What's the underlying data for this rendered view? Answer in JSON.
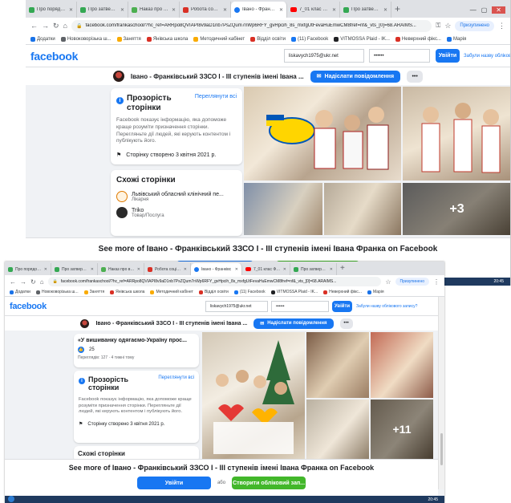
{
  "browser": {
    "tabs": [
      {
        "title": "Про порядок зап.",
        "icon": "drive-icon",
        "color": "#34a853"
      },
      {
        "title": "Про затвердженн",
        "icon": "drive-icon",
        "color": "#34a853"
      },
      {
        "title": "Наказ про викон",
        "icon": "mail-icon",
        "color": "#4caf50"
      },
      {
        "title": "Робота соціальн",
        "icon": "doc-icon",
        "color": "#d93025"
      },
      {
        "title": "Івано - Франківс",
        "icon": "facebook-icon",
        "color": "#1877f2",
        "active": true
      },
      {
        "title": "7_01 клас Фізика",
        "icon": "youtube-icon",
        "color": "#ff0000"
      },
      {
        "title": "Про затвердженн",
        "icon": "drive-icon",
        "color": "#34a853"
      }
    ],
    "new_tab": "+",
    "url": "facebook.com/frankaschool/?hc_ref=ARRpo8QVIAPI8v9aD1nb7PsZQum7nWp6RFY_gvHpcih_8s_mxfgUtFevaHuEmwCM8fref=nf&_vts_[0]=68.ARAIMS...",
    "profile_label": "Призупинено",
    "bookmarks": [
      {
        "label": "Додатки",
        "color": "#1a73e8"
      },
      {
        "label": "Новоковорізька ш...",
        "color": "#5f6368"
      },
      {
        "label": "Заняття",
        "color": "#f9ab00"
      },
      {
        "label": "Янівська школа",
        "color": "#d93025"
      },
      {
        "label": "Методичний кабінет",
        "color": "#f9ab00"
      },
      {
        "label": "Відділ освіти",
        "color": "#d93025"
      },
      {
        "label": "(11) Facebook",
        "color": "#1877f2"
      },
      {
        "label": "VITMOSSA Plaid - IK...",
        "color": "#202124"
      },
      {
        "label": "Неверхний фікс...",
        "color": "#d93025"
      },
      {
        "label": "Марія",
        "color": "#1a73e8"
      }
    ],
    "time": "20:45"
  },
  "fb": {
    "logo": "facebook",
    "email_value": "liskavych1975@ukr.net",
    "password_mask": "••••••",
    "login_label": "Увійти",
    "forgot_label": "Забули назву облікового запису?",
    "page_name": "Івано - Франківський ЗЗСО І - ІІІ ступенів імені Івана ...",
    "send_message": "Надіслати повідомлення",
    "more": "•••",
    "transparency": {
      "title": "Прозорість сторінки",
      "see_all": "Переглянути всі",
      "text": "Facebook показує інформацію, яка допоможе краще розуміти призначення сторінки. Перегляньте дії людей, які керують контентом і публікують його.",
      "created": "Сторінку створено 3 квітня 2021 р."
    },
    "similar": {
      "title": "Схожі сторінки",
      "items": [
        {
          "name": "Львівський обласний клінічний пе...",
          "category": "Лікарня"
        },
        {
          "name": "Triko",
          "category": "Товар/Послуга"
        }
      ]
    },
    "post": {
      "title": "«У вишиванку одягаємо-Україну прос...",
      "likes": "25",
      "views": "Переглядів: 127 · 4 тижні тому"
    },
    "photo_overlay_1": "+3",
    "photo_overlay_2": "+11",
    "banner_text": "See more of Івано - Франківський ЗЗСО І - ІІІ ступенів імені Івана Франка on Facebook",
    "banner_login": "Увійти",
    "banner_or": "або",
    "banner_create": "Створити обліковий зап..."
  }
}
